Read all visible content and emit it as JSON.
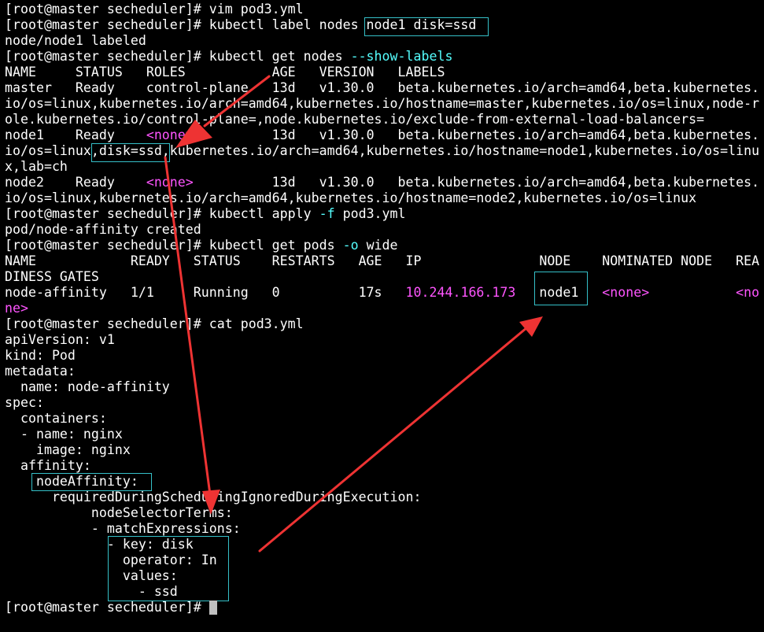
{
  "terminal": {
    "lines": [
      {
        "segments": [
          {
            "t": "[root@master secheduler]# vim pod3.yml"
          }
        ]
      },
      {
        "segments": [
          {
            "t": "[root@master secheduler]# kubectl label nodes node1 disk=ssd"
          }
        ]
      },
      {
        "segments": [
          {
            "t": "node/node1 labeled"
          }
        ]
      },
      {
        "segments": [
          {
            "t": "[root@master secheduler]# kubectl get nodes "
          },
          {
            "t": "--show-labels",
            "c": "c-cyan"
          }
        ]
      },
      {
        "segments": [
          {
            "t": "NAME     STATUS   ROLES           AGE   VERSION   LABELS"
          }
        ]
      },
      {
        "segments": [
          {
            "t": "master   Ready    control-plane   13d   v1.30.0   beta.kubernetes.io/arch=amd64,beta.kubernetes."
          }
        ]
      },
      {
        "segments": [
          {
            "t": "io/os=linux,kubernetes.io/arch=amd64,kubernetes.io/hostname=master,kubernetes.io/os=linux,node-r"
          }
        ]
      },
      {
        "segments": [
          {
            "t": "ole.kubernetes.io/control-plane=,node.kubernetes.io/exclude-from-external-load-balancers="
          }
        ]
      },
      {
        "segments": [
          {
            "t": "node1    Ready    "
          },
          {
            "t": "<none>",
            "c": "c-purple"
          },
          {
            "t": "          13d   v1.30.0   beta.kubernetes.io/arch=amd64,beta.kubernetes."
          }
        ]
      },
      {
        "segments": [
          {
            "t": "io/os=linux,disk=ssd,kubernetes.io/arch=amd64,kubernetes.io/hostname=node1,kubernetes.io/os=linu"
          }
        ]
      },
      {
        "segments": [
          {
            "t": "x,lab=ch"
          }
        ]
      },
      {
        "segments": [
          {
            "t": "node2    Ready    "
          },
          {
            "t": "<none>",
            "c": "c-purple"
          },
          {
            "t": "          13d   v1.30.0   beta.kubernetes.io/arch=amd64,beta.kubernetes."
          }
        ]
      },
      {
        "segments": [
          {
            "t": "io/os=linux,kubernetes.io/arch=amd64,kubernetes.io/hostname=node2,kubernetes.io/os=linux"
          }
        ]
      },
      {
        "segments": [
          {
            "t": "[root@master secheduler]# kubectl apply "
          },
          {
            "t": "-f",
            "c": "c-cyan"
          },
          {
            "t": " pod3.yml"
          }
        ]
      },
      {
        "segments": [
          {
            "t": "pod/node-affinity created"
          }
        ]
      },
      {
        "segments": [
          {
            "t": "[root@master secheduler]# kubectl get pods "
          },
          {
            "t": "-o",
            "c": "c-cyan"
          },
          {
            "t": " wide"
          }
        ]
      },
      {
        "segments": [
          {
            "t": "NAME            READY   STATUS    RESTARTS   AGE   IP               NODE    NOMINATED NODE   REA"
          }
        ]
      },
      {
        "segments": [
          {
            "t": "DINESS GATES"
          }
        ]
      },
      {
        "segments": [
          {
            "t": "node-affinity   1/1     Running   0          17s   "
          },
          {
            "t": "10.244.166.173",
            "c": "c-purple"
          },
          {
            "t": "   node1   "
          },
          {
            "t": "<none>",
            "c": "c-purple"
          },
          {
            "t": "           "
          },
          {
            "t": "<no",
            "c": "c-purple"
          }
        ]
      },
      {
        "segments": [
          {
            "t": "ne>",
            "c": "c-purple"
          }
        ]
      },
      {
        "segments": [
          {
            "t": "[root@master secheduler]# cat pod3.yml"
          }
        ]
      },
      {
        "segments": [
          {
            "t": "apiVersion: v1"
          }
        ]
      },
      {
        "segments": [
          {
            "t": "kind: Pod"
          }
        ]
      },
      {
        "segments": [
          {
            "t": "metadata:"
          }
        ]
      },
      {
        "segments": [
          {
            "t": "  name: node-affinity"
          }
        ]
      },
      {
        "segments": [
          {
            "t": "spec:"
          }
        ]
      },
      {
        "segments": [
          {
            "t": "  containers:"
          }
        ]
      },
      {
        "segments": [
          {
            "t": "  - name: nginx"
          }
        ]
      },
      {
        "segments": [
          {
            "t": "    image: nginx"
          }
        ]
      },
      {
        "segments": [
          {
            "t": "  affinity:"
          }
        ]
      },
      {
        "segments": [
          {
            "t": "    nodeAffinity:"
          }
        ]
      },
      {
        "segments": [
          {
            "t": "      requiredDuringSchedulingIgnoredDuringExecution:"
          }
        ]
      },
      {
        "segments": [
          {
            "t": "           nodeSelectorTerms:"
          }
        ]
      },
      {
        "segments": [
          {
            "t": "           - matchExpressions:"
          }
        ]
      },
      {
        "segments": [
          {
            "t": "             - key: disk"
          }
        ]
      },
      {
        "segments": [
          {
            "t": "               operator: In"
          }
        ]
      },
      {
        "segments": [
          {
            "t": "               values:"
          }
        ]
      },
      {
        "segments": [
          {
            "t": "                 - ssd"
          }
        ]
      },
      {
        "segments": [
          {
            "t": "[root@master secheduler]# "
          }
        ]
      }
    ]
  },
  "colors": {
    "background": "#000000",
    "text": "#ffffff",
    "purple": "#ff55ff",
    "cyan": "#55ffff",
    "highlight_box": "#35c0c8",
    "arrow": "#ee3333",
    "cursor": "#c0c0c0"
  }
}
